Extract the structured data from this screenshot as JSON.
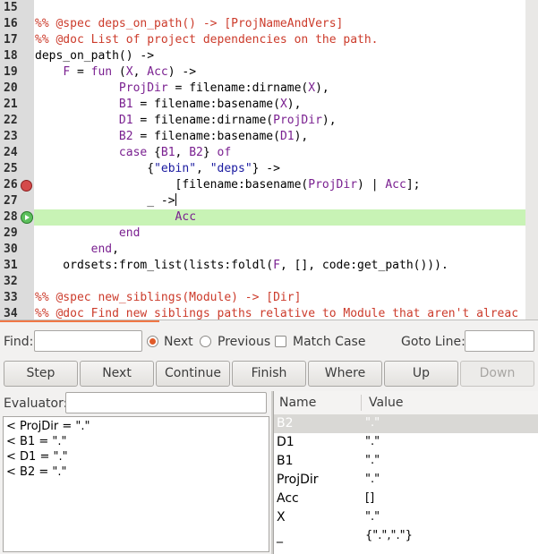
{
  "code": {
    "lines": [
      {
        "num": "15"
      },
      {
        "num": "16",
        "parts": [
          {
            "c": "com",
            "t": "%% @spec deps_on_path() -> [ProjNameAndVers]"
          }
        ]
      },
      {
        "num": "17",
        "parts": [
          {
            "c": "com",
            "t": "%% @doc List of project dependencies on the path."
          }
        ]
      },
      {
        "num": "18",
        "parts": [
          {
            "c": "",
            "t": "deps_on_path() ->"
          }
        ]
      },
      {
        "num": "19",
        "parts": [
          {
            "c": "",
            "t": "    "
          },
          {
            "c": "var",
            "t": "F"
          },
          {
            "c": "",
            "t": " = "
          },
          {
            "c": "kw",
            "t": "fun"
          },
          {
            "c": "",
            "t": " ("
          },
          {
            "c": "var",
            "t": "X"
          },
          {
            "c": "",
            "t": ", "
          },
          {
            "c": "var",
            "t": "Acc"
          },
          {
            "c": "",
            "t": ") ->"
          }
        ]
      },
      {
        "num": "20",
        "parts": [
          {
            "c": "",
            "t": "            "
          },
          {
            "c": "var",
            "t": "ProjDir"
          },
          {
            "c": "",
            "t": " = filename:dirname("
          },
          {
            "c": "var",
            "t": "X"
          },
          {
            "c": "",
            "t": "),"
          }
        ]
      },
      {
        "num": "21",
        "parts": [
          {
            "c": "",
            "t": "            "
          },
          {
            "c": "var",
            "t": "B1"
          },
          {
            "c": "",
            "t": " = filename:basename("
          },
          {
            "c": "var",
            "t": "X"
          },
          {
            "c": "",
            "t": "),"
          }
        ]
      },
      {
        "num": "22",
        "parts": [
          {
            "c": "",
            "t": "            "
          },
          {
            "c": "var",
            "t": "D1"
          },
          {
            "c": "",
            "t": " = filename:dirname("
          },
          {
            "c": "var",
            "t": "ProjDir"
          },
          {
            "c": "",
            "t": "),"
          }
        ]
      },
      {
        "num": "23",
        "parts": [
          {
            "c": "",
            "t": "            "
          },
          {
            "c": "var",
            "t": "B2"
          },
          {
            "c": "",
            "t": " = filename:basename("
          },
          {
            "c": "var",
            "t": "D1"
          },
          {
            "c": "",
            "t": "),"
          }
        ]
      },
      {
        "num": "24",
        "parts": [
          {
            "c": "",
            "t": "            "
          },
          {
            "c": "kw",
            "t": "case"
          },
          {
            "c": "",
            "t": " {"
          },
          {
            "c": "var",
            "t": "B1"
          },
          {
            "c": "",
            "t": ", "
          },
          {
            "c": "var",
            "t": "B2"
          },
          {
            "c": "",
            "t": "} "
          },
          {
            "c": "kw",
            "t": "of"
          }
        ]
      },
      {
        "num": "25",
        "parts": [
          {
            "c": "",
            "t": "                {"
          },
          {
            "c": "str",
            "t": "\"ebin\""
          },
          {
            "c": "",
            "t": ", "
          },
          {
            "c": "str",
            "t": "\"deps\""
          },
          {
            "c": "",
            "t": "} ->"
          }
        ]
      },
      {
        "num": "26",
        "marker": "breakpoint",
        "parts": [
          {
            "c": "",
            "t": "                    [filename:basename("
          },
          {
            "c": "var",
            "t": "ProjDir"
          },
          {
            "c": "",
            "t": ") | "
          },
          {
            "c": "var",
            "t": "Acc"
          },
          {
            "c": "",
            "t": "];"
          }
        ]
      },
      {
        "num": "27",
        "parts": [
          {
            "c": "",
            "t": "                _ ->"
          }
        ],
        "caret": true
      },
      {
        "num": "28",
        "marker": "current",
        "highlight": true,
        "parts": [
          {
            "c": "",
            "t": "                    "
          },
          {
            "c": "var",
            "t": "Acc"
          }
        ]
      },
      {
        "num": "29",
        "parts": [
          {
            "c": "",
            "t": "            "
          },
          {
            "c": "kw",
            "t": "end"
          }
        ]
      },
      {
        "num": "30",
        "parts": [
          {
            "c": "",
            "t": "        "
          },
          {
            "c": "kw",
            "t": "end"
          },
          {
            "c": "",
            "t": ","
          }
        ]
      },
      {
        "num": "31",
        "parts": [
          {
            "c": "",
            "t": "    ordsets:from_list(lists:foldl("
          },
          {
            "c": "var",
            "t": "F"
          },
          {
            "c": "",
            "t": ", [], code:get_path()))."
          }
        ]
      },
      {
        "num": "32"
      },
      {
        "num": "33",
        "parts": [
          {
            "c": "com",
            "t": "%% @spec new_siblings(Module) -> [Dir]"
          }
        ]
      },
      {
        "num": "34",
        "parts": [
          {
            "c": "com",
            "t": "%% @doc Find new siblings paths relative to Module that aren't alreac"
          }
        ]
      }
    ]
  },
  "find": {
    "label": "Find:",
    "value": "",
    "next_label": "Next",
    "previous_label": "Previous",
    "match_case_label": "Match Case",
    "goto_label": "Goto Line:",
    "goto_value": ""
  },
  "buttons": {
    "step": "Step",
    "next": "Next",
    "continue": "Continue",
    "finish": "Finish",
    "where": "Where",
    "up": "Up",
    "down": "Down"
  },
  "evaluator": {
    "label": "Evaluator:",
    "value": "",
    "output": [
      "< ProjDir = \".\"",
      "< B1 = \".\"",
      "< D1 = \".\"",
      "< B2 = \".\""
    ]
  },
  "variables": {
    "col_name": "Name",
    "col_value": "Value",
    "rows": [
      {
        "name": "B2",
        "value": "\".\"",
        "selected": true
      },
      {
        "name": "D1",
        "value": "\".\""
      },
      {
        "name": "B1",
        "value": "\".\""
      },
      {
        "name": "ProjDir",
        "value": "\".\""
      },
      {
        "name": "Acc",
        "value": "[]"
      },
      {
        "name": "X",
        "value": "\".\""
      },
      {
        "name": "_",
        "value": "{\".\",\".\"}"
      }
    ]
  },
  "colors": {
    "comment": "#cc3b2b",
    "keyword": "#7a2090",
    "string": "#1a1aa0",
    "current_line": "#c8f3b5",
    "breakpoint": "#d44a4a",
    "radio_accent": "#e05a28",
    "tab_indicator": "#f07746"
  }
}
